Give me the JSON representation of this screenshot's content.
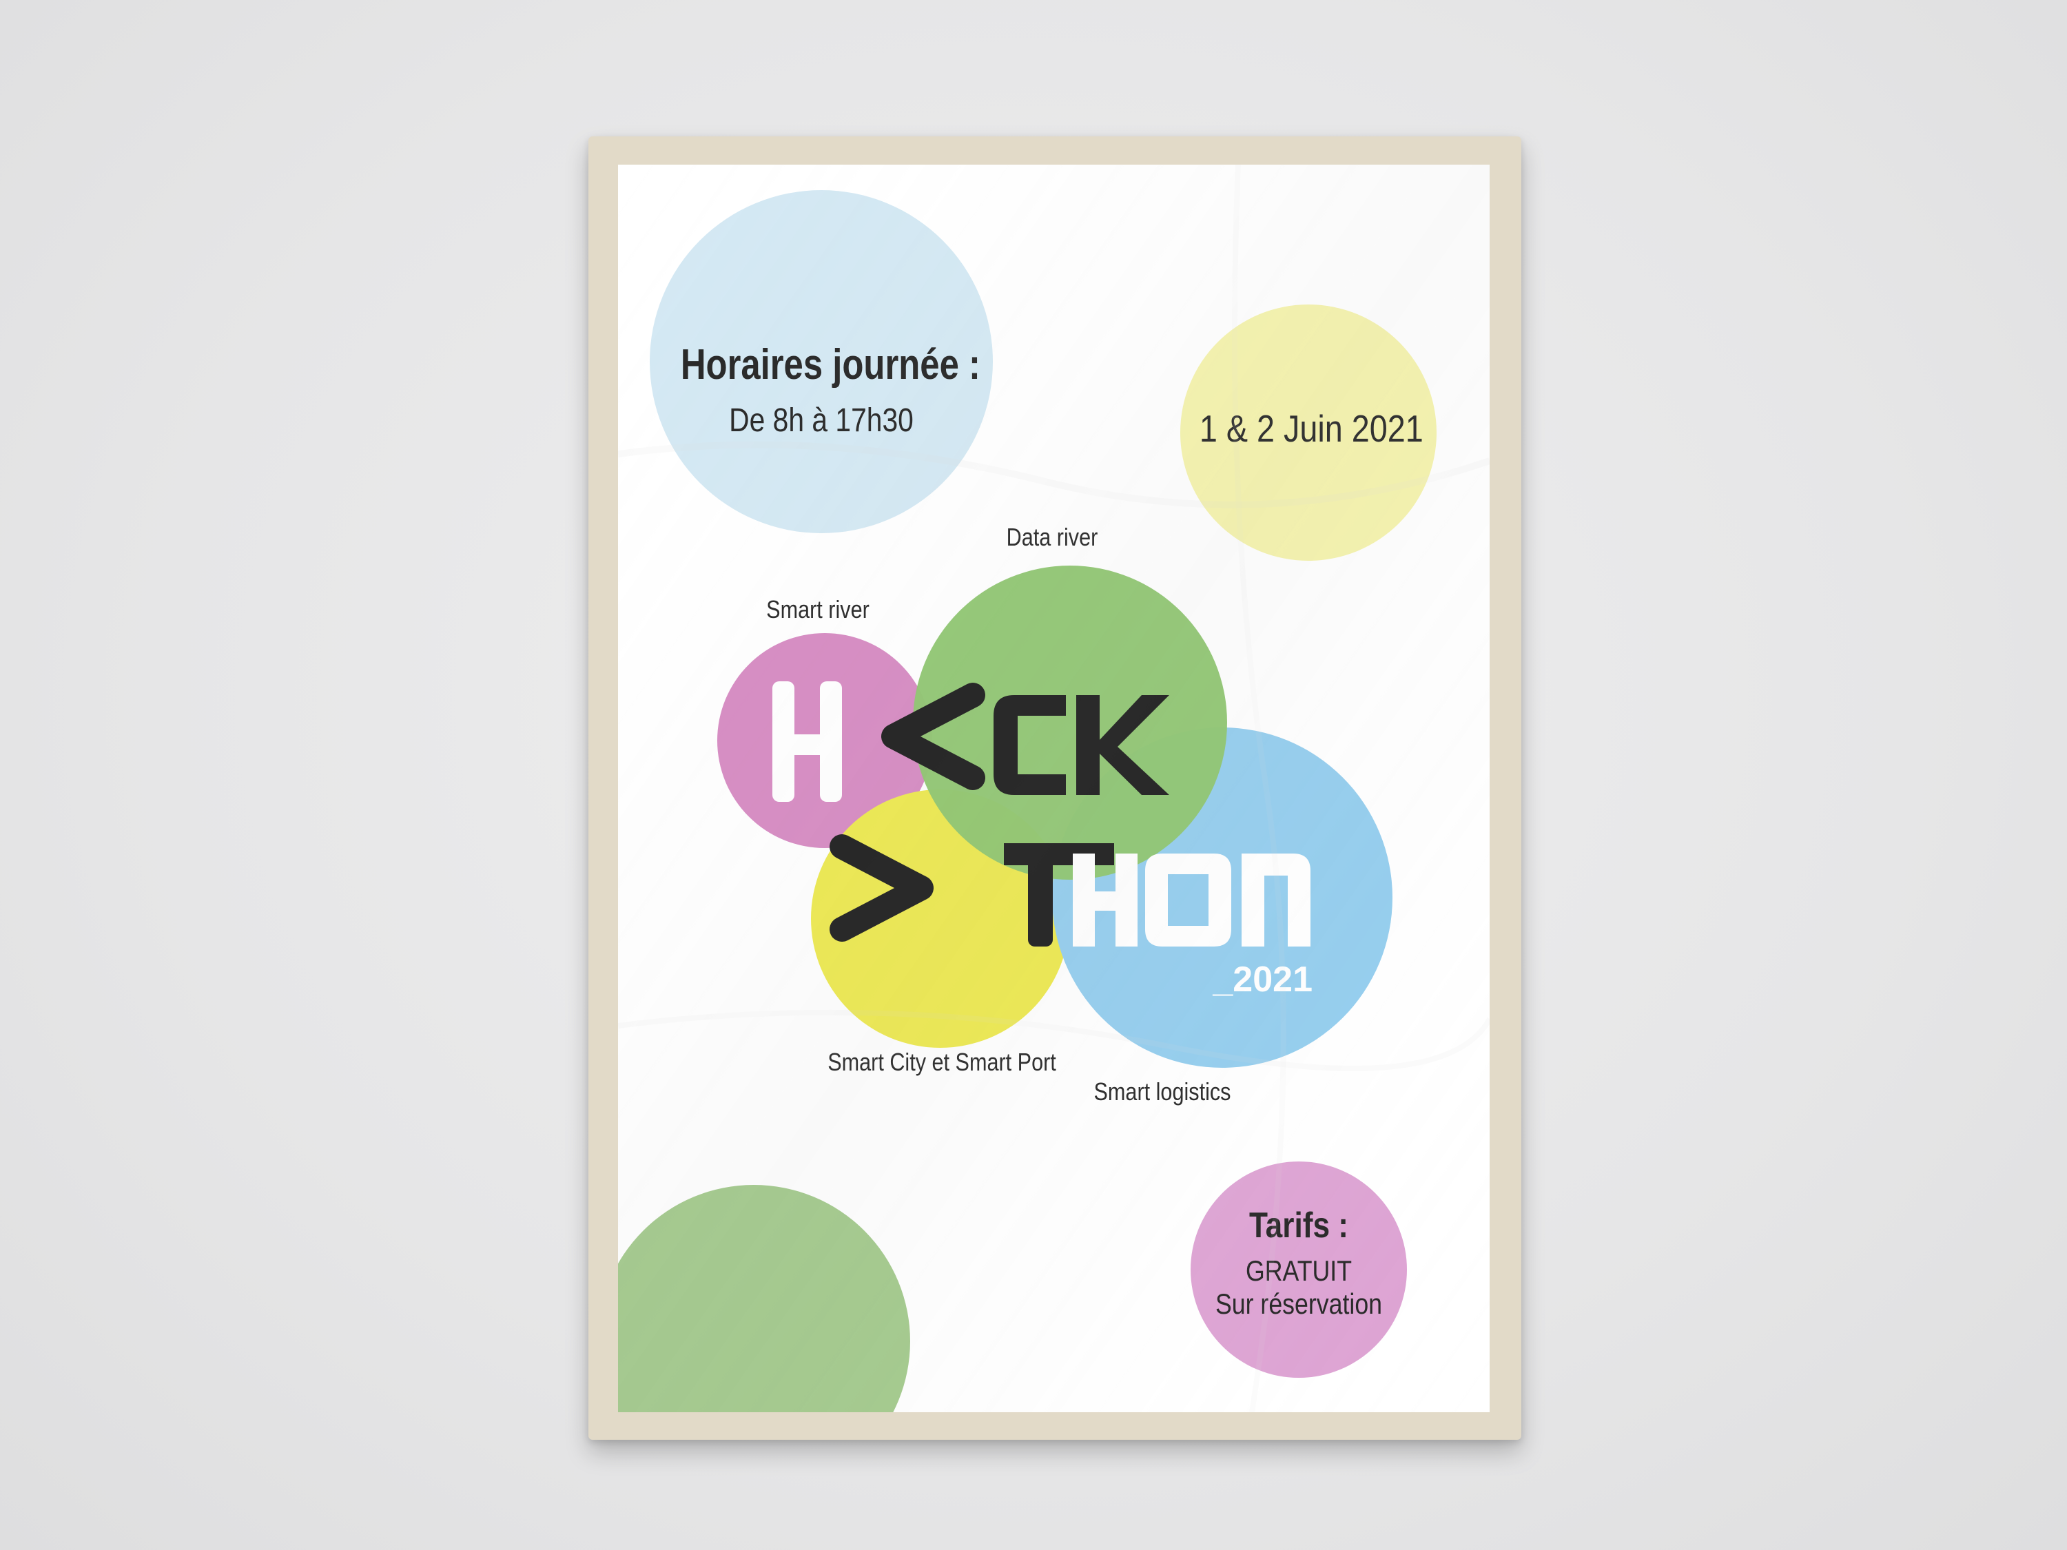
{
  "poster": {
    "schedule": {
      "title": "Horaires journée :",
      "hours": "De 8h à 17h30"
    },
    "date": "1 & 2 Juin 2021",
    "logo": {
      "line1": "H<CK",
      "line2": ">THON",
      "year": "_2021"
    },
    "themes": {
      "data_river": "Data river",
      "smart_river": "Smart river",
      "smart_city_port": "Smart City et Smart Port",
      "smart_logistics": "Smart logistics"
    },
    "pricing": {
      "title": "Tarifs :",
      "line1": "GRATUIT",
      "line2": "Sur réservation"
    },
    "colors": {
      "blue_light": "#d3e8f3",
      "yellow_light": "#f5f3ac",
      "pink": "#d68ac2",
      "green": "#8dc56e",
      "blue": "#93cdee",
      "yellow": "#ede94e",
      "frame": "#e2dac8"
    }
  }
}
